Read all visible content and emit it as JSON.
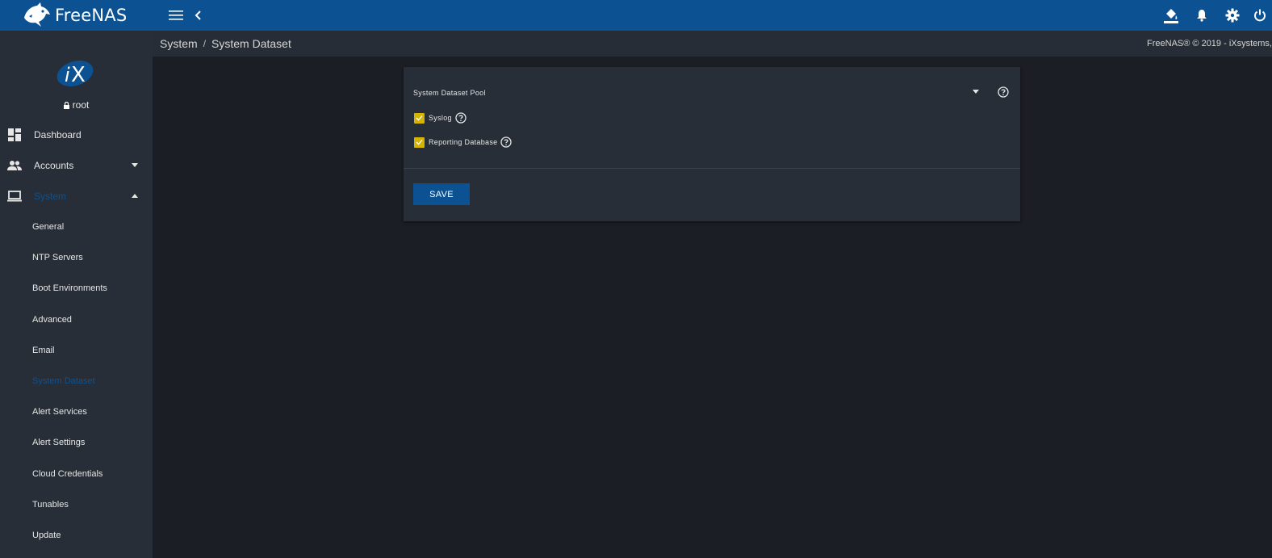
{
  "app": {
    "brand": "FreeNAS"
  },
  "topbar": {
    "menu_icon": "menu-icon",
    "back_icon": "chevron-left-icon",
    "right_icons": [
      "theme-bucket-icon",
      "bell-icon",
      "gear-icon",
      "power-icon"
    ]
  },
  "sidebar": {
    "user": "root",
    "items": [
      {
        "label": "Dashboard",
        "icon": "dashboard-icon"
      },
      {
        "label": "Accounts",
        "icon": "people-icon"
      },
      {
        "label": "System",
        "icon": "laptop-icon"
      }
    ],
    "system_subitems": [
      {
        "label": "General"
      },
      {
        "label": "NTP Servers"
      },
      {
        "label": "Boot Environments"
      },
      {
        "label": "Advanced"
      },
      {
        "label": "Email"
      },
      {
        "label": "System Dataset"
      },
      {
        "label": "Alert Services"
      },
      {
        "label": "Alert Settings"
      },
      {
        "label": "Cloud Credentials"
      },
      {
        "label": "Tunables"
      },
      {
        "label": "Update"
      }
    ],
    "active_color": "#0c5293"
  },
  "breadcrumb": {
    "parent": "System",
    "separator": "/",
    "current": "System Dataset"
  },
  "copyright": "FreeNAS® © 2019 - iXsystems,",
  "form": {
    "pool_label": "System Dataset Pool",
    "checkboxes": [
      {
        "label": "Syslog",
        "checked": true
      },
      {
        "label": "Reporting Database",
        "checked": true
      }
    ],
    "save_label": "SAVE"
  },
  "colors": {
    "primary": "#0c5293",
    "checkbox": "#d4b400",
    "background": "#1b1e24",
    "panel": "#282e37"
  }
}
